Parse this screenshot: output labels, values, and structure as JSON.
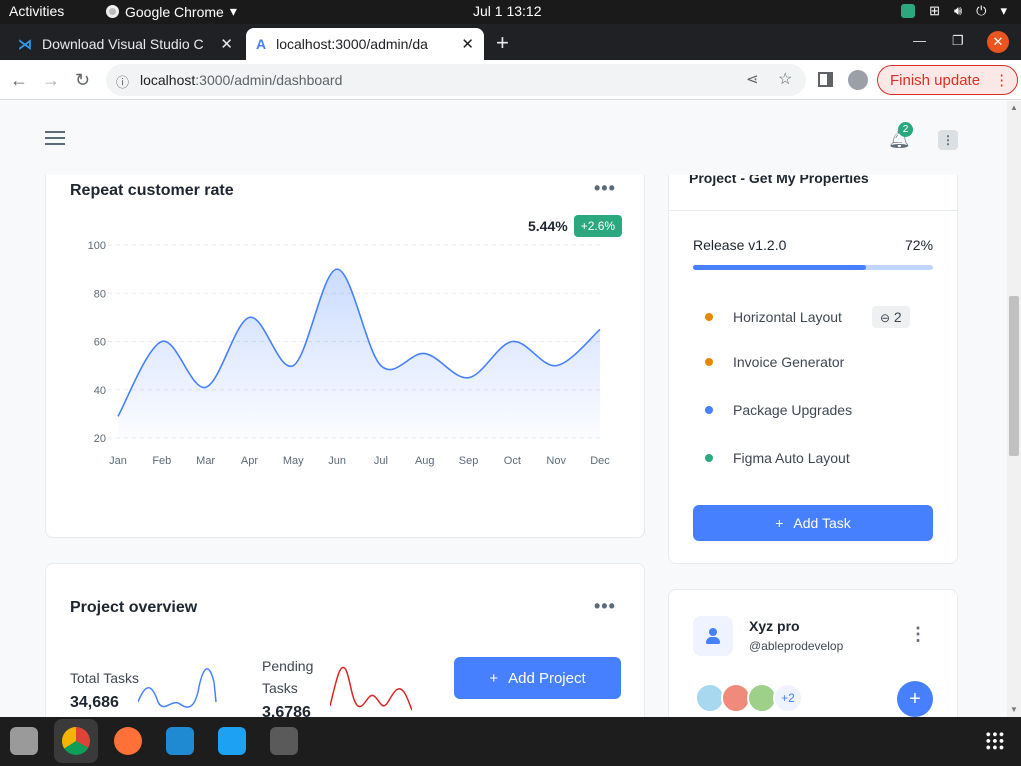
{
  "os": {
    "activities": "Activities",
    "app_name": "Google Chrome",
    "clock": "Jul 1  13:12"
  },
  "browser": {
    "tabs": [
      {
        "title": "Download Visual Studio C"
      },
      {
        "title": "localhost:3000/admin/da"
      }
    ],
    "url_host": "localhost",
    "url_path": ":3000/admin/dashboard",
    "finish_update": "Finish update"
  },
  "header": {
    "notification_count": "2"
  },
  "repeat_card": {
    "title": "Repeat customer rate",
    "value": "5.44%",
    "change": "+2.6%"
  },
  "chart_data": {
    "type": "area",
    "title": "Repeat customer rate",
    "categories": [
      "Jan",
      "Feb",
      "Mar",
      "Apr",
      "May",
      "Jun",
      "Jul",
      "Aug",
      "Sep",
      "Oct",
      "Nov",
      "Dec"
    ],
    "series": [
      {
        "values": [
          29,
          60,
          41,
          70,
          50,
          90,
          50,
          55,
          45,
          60,
          50,
          65
        ]
      }
    ],
    "yticks": [
      100,
      80,
      60,
      40,
      20
    ],
    "ylim": [
      20,
      100
    ],
    "grid": true,
    "color": "#4680ff"
  },
  "project_card": {
    "title": "Project - Get My Properties",
    "release_label": "Release v1.2.0",
    "release_percent": "72%",
    "progress": 0.72,
    "tasks": [
      {
        "label": "Horizontal Layout",
        "color": "#e58a00",
        "badge": "2"
      },
      {
        "label": "Invoice Generator",
        "color": "#e58a00"
      },
      {
        "label": "Package Upgrades",
        "color": "#4680ff"
      },
      {
        "label": "Figma Auto Layout",
        "color": "#2ca87f"
      }
    ],
    "add_task": "Add Task"
  },
  "overview_card": {
    "title": "Project overview",
    "total_label": "Total Tasks",
    "total_value": "34,686",
    "pending_label_1": "Pending",
    "pending_label_2": "Tasks",
    "pending_value": "3.6786",
    "add_project": "Add Project"
  },
  "profile_card": {
    "name": "Xyz pro",
    "handle": "@ableprodevelop",
    "more_count": "+2"
  }
}
